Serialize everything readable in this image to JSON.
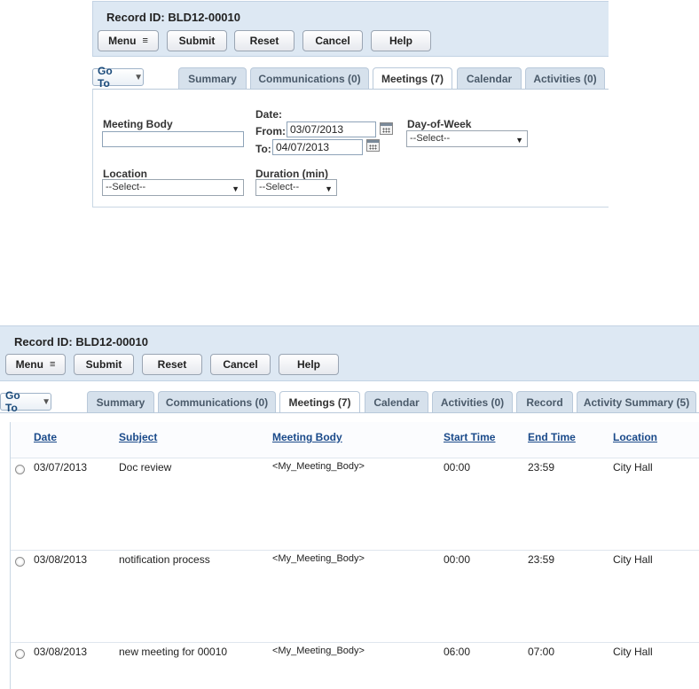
{
  "top": {
    "record_id": "Record ID: BLD12-00010",
    "buttons": {
      "menu": "Menu",
      "submit": "Submit",
      "reset": "Reset",
      "cancel": "Cancel",
      "help": "Help"
    },
    "goto": "Go To",
    "tabs": [
      "Summary",
      "Communications (0)",
      "Meetings (7)",
      "Calendar",
      "Activities (0)"
    ],
    "active_tab": "Meetings (7)",
    "search": {
      "meeting_body_label": "Meeting Body",
      "meeting_body_value": "",
      "date_label": "Date:",
      "from_label": "From:",
      "from_value": "03/07/2013",
      "to_label": "To:",
      "to_value": "04/07/2013",
      "dow_label": "Day-of-Week",
      "dow_value": "--Select--",
      "location_label": "Location",
      "location_value": "--Select--",
      "duration_label": "Duration (min)",
      "duration_value": "--Select--"
    }
  },
  "bottom": {
    "record_id": "Record ID: BLD12-00010",
    "buttons": {
      "menu": "Menu",
      "submit": "Submit",
      "reset": "Reset",
      "cancel": "Cancel",
      "help": "Help"
    },
    "goto": "Go To",
    "tabs": [
      "Summary",
      "Communications (0)",
      "Meetings (7)",
      "Calendar",
      "Activities (0)",
      "Record",
      "Activity Summary (5)"
    ],
    "active_tab": "Meetings (7)",
    "grid": {
      "columns": [
        "Date",
        "Subject",
        "Meeting Body",
        "Start Time",
        "End Time",
        "Location"
      ],
      "rows": [
        [
          "03/07/2013",
          "Doc review",
          "<My_Meeting_Body>",
          "00:00",
          "23:59",
          "City Hall"
        ],
        [
          "03/08/2013",
          "notification process",
          "<My_Meeting_Body>",
          "00:00",
          "23:59",
          "City Hall"
        ],
        [
          "03/08/2013",
          "new meeting for 00010",
          "<My_Meeting_Body>",
          "06:00",
          "07:00",
          "City Hall"
        ]
      ]
    }
  },
  "colors": {
    "header_bg": "#dde8f3",
    "tab_bg": "#d6e1ec",
    "link_blue": "#1a4a8a"
  }
}
